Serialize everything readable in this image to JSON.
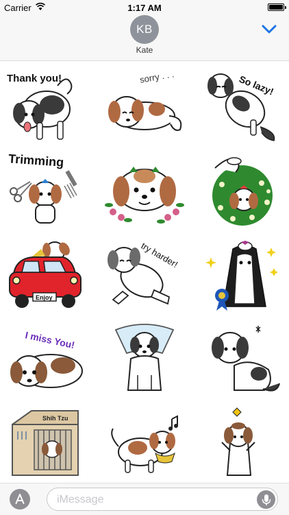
{
  "status_bar": {
    "carrier": "Carrier",
    "time": "1:17 AM"
  },
  "header": {
    "avatar_initials": "KB",
    "contact_name": "Kate"
  },
  "stickers": [
    {
      "text": "Thank you!"
    },
    {
      "text": "sorry . . ."
    },
    {
      "text": "So lazy!"
    },
    {
      "text": "Trimming"
    },
    {
      "text": ""
    },
    {
      "text": ""
    },
    {
      "text": "Enjoy"
    },
    {
      "text": "try harder!"
    },
    {
      "text": ""
    },
    {
      "text": "I miss You!"
    },
    {
      "text": ""
    },
    {
      "text": ""
    },
    {
      "text": "Shih Tzu"
    },
    {
      "text": ""
    },
    {
      "text": ""
    }
  ],
  "composer": {
    "placeholder": "iMessage"
  },
  "colors": {
    "accent": "#1b74e4",
    "avatar": "#8e939b",
    "brown": "#8a5a3a",
    "car_red": "#e1232b",
    "leaf_green": "#2f8a2f",
    "ribbon_blue": "#1f56b8"
  }
}
